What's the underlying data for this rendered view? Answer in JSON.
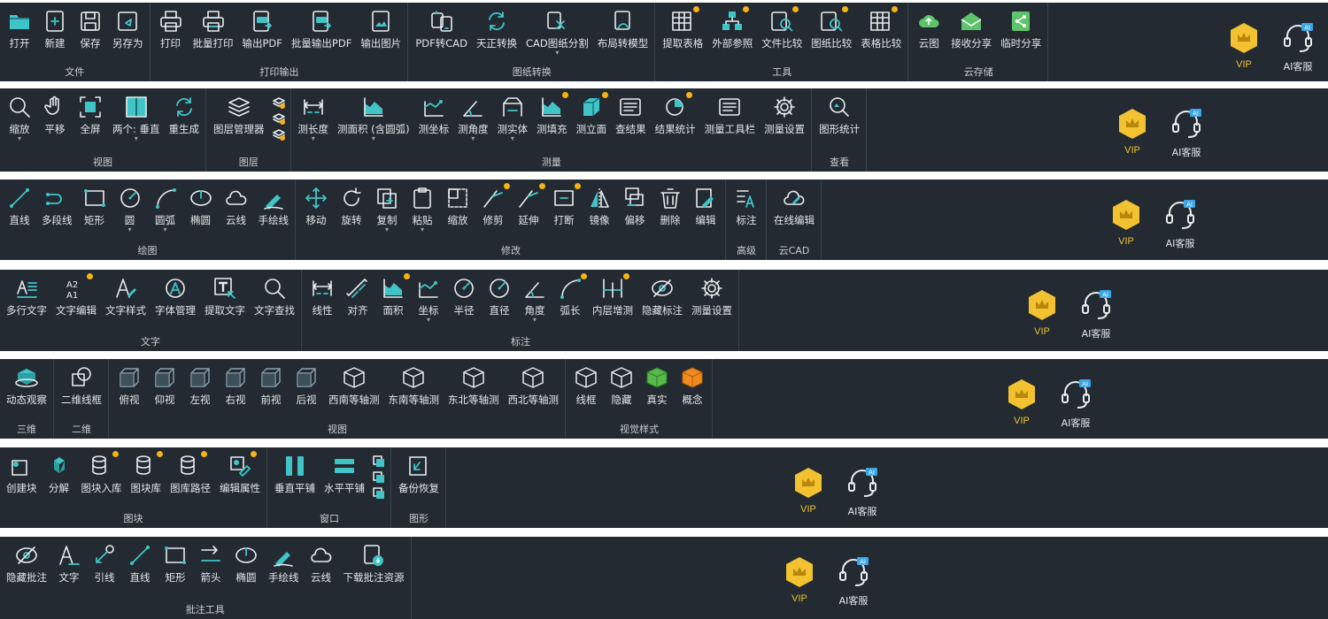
{
  "colors": {
    "background": "#232a31",
    "icon": "#3fc4c8",
    "accent_dot": "#f5b316",
    "vip": "#f2c230",
    "text": "#e2e6ea"
  },
  "common": {
    "vip_label": "VIP",
    "kefu_label": "AI客服",
    "kefu_badge": "AI"
  },
  "rows": [
    {
      "groups": [
        {
          "label": "文件",
          "tools": [
            {
              "label": "打开",
              "icon": "folder-open-icon"
            },
            {
              "label": "新建",
              "icon": "new-file-icon"
            },
            {
              "label": "保存",
              "icon": "save-icon"
            },
            {
              "label": "另存为",
              "icon": "save-as-icon"
            }
          ]
        },
        {
          "label": "打印输出",
          "tools": [
            {
              "label": "打印",
              "icon": "printer-icon"
            },
            {
              "label": "批量打印",
              "icon": "batch-print-icon"
            },
            {
              "label": "输出PDF",
              "icon": "export-pdf-icon"
            },
            {
              "label": "批量输出PDF",
              "icon": "batch-pdf-icon"
            },
            {
              "label": "输出图片",
              "icon": "export-image-icon"
            }
          ]
        },
        {
          "label": "图纸转换",
          "tools": [
            {
              "label": "PDF转CAD",
              "icon": "pdf-to-cad-icon"
            },
            {
              "label": "天正转换",
              "icon": "convert-cycle-icon"
            },
            {
              "label": "CAD图纸分割",
              "icon": "split-drawing-icon",
              "caret": true
            },
            {
              "label": "布局转模型",
              "icon": "layout-to-model-icon"
            }
          ]
        },
        {
          "label": "工具",
          "tools": [
            {
              "label": "提取表格",
              "icon": "extract-table-icon",
              "dot": true
            },
            {
              "label": "外部参照",
              "icon": "external-ref-icon",
              "dot": true
            },
            {
              "label": "文件比较",
              "icon": "file-compare-icon",
              "dot": true
            },
            {
              "label": "图纸比较",
              "icon": "drawing-compare-icon",
              "dot": true
            },
            {
              "label": "表格比较",
              "icon": "table-compare-icon",
              "dot": true
            }
          ]
        },
        {
          "label": "云存储",
          "tools": [
            {
              "label": "云图",
              "icon": "cloud-icon"
            },
            {
              "label": "接收分享",
              "icon": "inbox-icon"
            },
            {
              "label": "临时分享",
              "icon": "share-icon"
            }
          ]
        }
      ]
    },
    {
      "groups": [
        {
          "label": "视图",
          "tools": [
            {
              "label": "缩放",
              "icon": "zoom-icon",
              "caret": true
            },
            {
              "label": "平移",
              "icon": "hand-pan-icon"
            },
            {
              "label": "全屏",
              "icon": "fullscreen-icon"
            },
            {
              "label": "两个: 垂直",
              "icon": "split-vertical-icon",
              "caret": true
            },
            {
              "label": "重生成",
              "icon": "regenerate-icon"
            }
          ]
        },
        {
          "label": "图层",
          "tools": [
            {
              "label": "图层管理器",
              "icon": "layers-icon"
            }
          ],
          "stack": [
            "layer-state-icon",
            "layer-filter-icon",
            "layer-off-icon"
          ]
        },
        {
          "label": "测量",
          "tools": [
            {
              "label": "测长度",
              "icon": "measure-length-icon",
              "caret": true
            },
            {
              "label": "测面积 (含圆弧)",
              "icon": "measure-area-icon",
              "caret": true
            },
            {
              "label": "测坐标",
              "icon": "measure-coordinate-icon"
            },
            {
              "label": "测角度",
              "icon": "measure-angle-icon",
              "caret": true
            },
            {
              "label": "测实体",
              "icon": "measure-entity-icon",
              "caret": true
            },
            {
              "label": "测填充",
              "icon": "measure-hatch-icon",
              "dot": true
            },
            {
              "label": "测立面",
              "icon": "measure-elevation-icon",
              "dot": true
            },
            {
              "label": "查结果",
              "icon": "view-results-icon"
            },
            {
              "label": "结果统计",
              "icon": "result-stats-icon",
              "dot": true
            },
            {
              "label": "测量工具栏",
              "icon": "measure-toolbar-icon"
            },
            {
              "label": "测量设置",
              "icon": "gear-icon"
            }
          ]
        },
        {
          "label": "查看",
          "tools": [
            {
              "label": "图形统计",
              "icon": "graphic-stats-icon"
            }
          ]
        }
      ]
    },
    {
      "groups": [
        {
          "label": "绘图",
          "tools": [
            {
              "label": "直线",
              "icon": "line-icon"
            },
            {
              "label": "多段线",
              "icon": "polyline-icon"
            },
            {
              "label": "矩形",
              "icon": "rectangle-icon"
            },
            {
              "label": "圆",
              "icon": "circle-icon",
              "caret": true
            },
            {
              "label": "圆弧",
              "icon": "arc-icon",
              "caret": true
            },
            {
              "label": "椭圆",
              "icon": "ellipse-icon"
            },
            {
              "label": "云线",
              "icon": "revcloud-icon"
            },
            {
              "label": "手绘线",
              "icon": "freehand-icon"
            }
          ]
        },
        {
          "label": "修改",
          "tools": [
            {
              "label": "移动",
              "icon": "move-icon"
            },
            {
              "label": "旋转",
              "icon": "rotate-icon"
            },
            {
              "label": "复制",
              "icon": "copy-icon",
              "caret": true
            },
            {
              "label": "粘贴",
              "icon": "paste-icon",
              "caret": true
            },
            {
              "label": "缩放",
              "icon": "scale-icon"
            },
            {
              "label": "修剪",
              "icon": "trim-icon",
              "dot": true
            },
            {
              "label": "延伸",
              "icon": "extend-icon",
              "dot": true
            },
            {
              "label": "打断",
              "icon": "break-icon",
              "dot": true
            },
            {
              "label": "镜像",
              "icon": "mirror-icon"
            },
            {
              "label": "偏移",
              "icon": "offset-icon"
            },
            {
              "label": "删除",
              "icon": "delete-icon"
            },
            {
              "label": "编辑",
              "icon": "edit-icon"
            }
          ]
        },
        {
          "label": "高级",
          "tools": [
            {
              "label": "标注",
              "icon": "annotate-icon"
            }
          ]
        },
        {
          "label": "云CAD",
          "tools": [
            {
              "label": "在线编辑",
              "icon": "cloud-edit-icon"
            }
          ]
        }
      ]
    },
    {
      "groups": [
        {
          "label": "文字",
          "tools": [
            {
              "label": "多行文字",
              "icon": "mtext-icon"
            },
            {
              "label": "文字编辑",
              "icon": "text-edit-icon",
              "dot": true
            },
            {
              "label": "文字样式",
              "icon": "text-style-icon"
            },
            {
              "label": "字体管理",
              "icon": "font-manager-icon"
            },
            {
              "label": "提取文字",
              "icon": "extract-text-icon"
            },
            {
              "label": "文字查找",
              "icon": "text-search-icon"
            }
          ]
        },
        {
          "label": "标注",
          "tools": [
            {
              "label": "线性",
              "icon": "dim-linear-icon"
            },
            {
              "label": "对齐",
              "icon": "dim-aligned-icon"
            },
            {
              "label": "面积",
              "icon": "dim-area-icon",
              "dot": true
            },
            {
              "label": "坐标",
              "icon": "dim-coordinate-icon",
              "caret": true
            },
            {
              "label": "半径",
              "icon": "dim-radius-icon"
            },
            {
              "label": "直径",
              "icon": "dim-diameter-icon"
            },
            {
              "label": "角度",
              "icon": "dim-angle-icon",
              "caret": true
            },
            {
              "label": "弧长",
              "icon": "dim-arc-length-icon",
              "dot": true
            },
            {
              "label": "内层增测",
              "icon": "dim-inner-icon",
              "dot": true
            },
            {
              "label": "隐藏标注",
              "icon": "hide-dim-icon"
            },
            {
              "label": "测量设置",
              "icon": "gear-icon"
            }
          ]
        }
      ]
    },
    {
      "groups": [
        {
          "label": "三维",
          "tools": [
            {
              "label": "动态观察",
              "icon": "orbit-icon"
            }
          ]
        },
        {
          "label": "二维",
          "tools": [
            {
              "label": "二维线框",
              "icon": "wireframe-2d-icon"
            }
          ]
        },
        {
          "label": "视图",
          "tools": [
            {
              "label": "俯视",
              "icon": "view-top-icon"
            },
            {
              "label": "仰视",
              "icon": "view-bottom-icon"
            },
            {
              "label": "左视",
              "icon": "view-left-icon"
            },
            {
              "label": "右视",
              "icon": "view-right-icon"
            },
            {
              "label": "前视",
              "icon": "view-front-icon"
            },
            {
              "label": "后视",
              "icon": "view-back-icon"
            },
            {
              "label": "西南等轴测",
              "icon": "iso-sw-icon"
            },
            {
              "label": "东南等轴测",
              "icon": "iso-se-icon"
            },
            {
              "label": "东北等轴测",
              "icon": "iso-ne-icon"
            },
            {
              "label": "西北等轴测",
              "icon": "iso-nw-icon"
            }
          ]
        },
        {
          "label": "视觉样式",
          "tools": [
            {
              "label": "线框",
              "icon": "style-wireframe-icon"
            },
            {
              "label": "隐藏",
              "icon": "style-hidden-icon"
            },
            {
              "label": "真实",
              "icon": "style-realistic-icon"
            },
            {
              "label": "概念",
              "icon": "style-conceptual-icon"
            }
          ]
        }
      ]
    },
    {
      "groups": [
        {
          "label": "图块",
          "tools": [
            {
              "label": "创建块",
              "icon": "create-block-icon"
            },
            {
              "label": "分解",
              "icon": "explode-icon"
            },
            {
              "label": "图块入库",
              "icon": "block-to-library-icon",
              "dot": true
            },
            {
              "label": "图块库",
              "icon": "block-library-icon",
              "dot": true
            },
            {
              "label": "图库路径",
              "icon": "library-path-icon",
              "dot": true
            },
            {
              "label": "编辑属性",
              "icon": "edit-attributes-icon",
              "dot": true
            }
          ]
        },
        {
          "label": "窗口",
          "tools": [
            {
              "label": "垂直平铺",
              "icon": "tile-vertical-icon"
            },
            {
              "label": "水平平铺",
              "icon": "tile-horizontal-icon"
            }
          ],
          "stack": [
            "cascade-icon",
            "window-arrange-icon",
            "window-list-icon"
          ]
        },
        {
          "label": "图形",
          "tools": [
            {
              "label": "备份恢复",
              "icon": "backup-restore-icon"
            }
          ]
        }
      ]
    },
    {
      "groups": [
        {
          "label": "批注工具",
          "tools": [
            {
              "label": "隐藏批注",
              "icon": "hide-annotation-icon"
            },
            {
              "label": "文字",
              "icon": "annotation-text-icon"
            },
            {
              "label": "引线",
              "icon": "leader-icon"
            },
            {
              "label": "直线",
              "icon": "annotation-line-icon"
            },
            {
              "label": "矩形",
              "icon": "annotation-rect-icon"
            },
            {
              "label": "箭头",
              "icon": "arrow-icon"
            },
            {
              "label": "椭圆",
              "icon": "annotation-ellipse-icon"
            },
            {
              "label": "手绘线",
              "icon": "annotation-freehand-icon"
            },
            {
              "label": "云线",
              "icon": "annotation-cloud-icon"
            },
            {
              "label": "下载批注资源",
              "icon": "download-annotation-icon"
            }
          ]
        }
      ]
    }
  ]
}
